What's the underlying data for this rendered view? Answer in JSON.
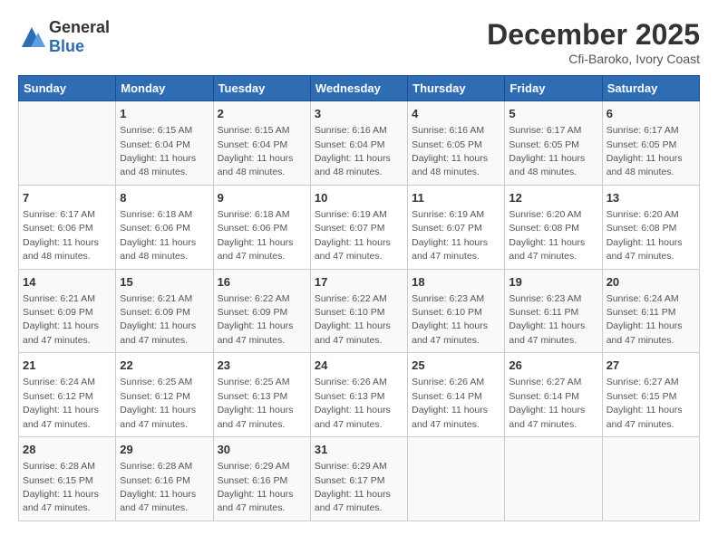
{
  "header": {
    "logo_general": "General",
    "logo_blue": "Blue",
    "month": "December 2025",
    "location": "Cfi-Baroko, Ivory Coast"
  },
  "days_of_week": [
    "Sunday",
    "Monday",
    "Tuesday",
    "Wednesday",
    "Thursday",
    "Friday",
    "Saturday"
  ],
  "weeks": [
    [
      {
        "day": "",
        "info": ""
      },
      {
        "day": "1",
        "info": "Sunrise: 6:15 AM\nSunset: 6:04 PM\nDaylight: 11 hours\nand 48 minutes."
      },
      {
        "day": "2",
        "info": "Sunrise: 6:15 AM\nSunset: 6:04 PM\nDaylight: 11 hours\nand 48 minutes."
      },
      {
        "day": "3",
        "info": "Sunrise: 6:16 AM\nSunset: 6:04 PM\nDaylight: 11 hours\nand 48 minutes."
      },
      {
        "day": "4",
        "info": "Sunrise: 6:16 AM\nSunset: 6:05 PM\nDaylight: 11 hours\nand 48 minutes."
      },
      {
        "day": "5",
        "info": "Sunrise: 6:17 AM\nSunset: 6:05 PM\nDaylight: 11 hours\nand 48 minutes."
      },
      {
        "day": "6",
        "info": "Sunrise: 6:17 AM\nSunset: 6:05 PM\nDaylight: 11 hours\nand 48 minutes."
      }
    ],
    [
      {
        "day": "7",
        "info": "Sunrise: 6:17 AM\nSunset: 6:06 PM\nDaylight: 11 hours\nand 48 minutes."
      },
      {
        "day": "8",
        "info": "Sunrise: 6:18 AM\nSunset: 6:06 PM\nDaylight: 11 hours\nand 48 minutes."
      },
      {
        "day": "9",
        "info": "Sunrise: 6:18 AM\nSunset: 6:06 PM\nDaylight: 11 hours\nand 47 minutes."
      },
      {
        "day": "10",
        "info": "Sunrise: 6:19 AM\nSunset: 6:07 PM\nDaylight: 11 hours\nand 47 minutes."
      },
      {
        "day": "11",
        "info": "Sunrise: 6:19 AM\nSunset: 6:07 PM\nDaylight: 11 hours\nand 47 minutes."
      },
      {
        "day": "12",
        "info": "Sunrise: 6:20 AM\nSunset: 6:08 PM\nDaylight: 11 hours\nand 47 minutes."
      },
      {
        "day": "13",
        "info": "Sunrise: 6:20 AM\nSunset: 6:08 PM\nDaylight: 11 hours\nand 47 minutes."
      }
    ],
    [
      {
        "day": "14",
        "info": "Sunrise: 6:21 AM\nSunset: 6:09 PM\nDaylight: 11 hours\nand 47 minutes."
      },
      {
        "day": "15",
        "info": "Sunrise: 6:21 AM\nSunset: 6:09 PM\nDaylight: 11 hours\nand 47 minutes."
      },
      {
        "day": "16",
        "info": "Sunrise: 6:22 AM\nSunset: 6:09 PM\nDaylight: 11 hours\nand 47 minutes."
      },
      {
        "day": "17",
        "info": "Sunrise: 6:22 AM\nSunset: 6:10 PM\nDaylight: 11 hours\nand 47 minutes."
      },
      {
        "day": "18",
        "info": "Sunrise: 6:23 AM\nSunset: 6:10 PM\nDaylight: 11 hours\nand 47 minutes."
      },
      {
        "day": "19",
        "info": "Sunrise: 6:23 AM\nSunset: 6:11 PM\nDaylight: 11 hours\nand 47 minutes."
      },
      {
        "day": "20",
        "info": "Sunrise: 6:24 AM\nSunset: 6:11 PM\nDaylight: 11 hours\nand 47 minutes."
      }
    ],
    [
      {
        "day": "21",
        "info": "Sunrise: 6:24 AM\nSunset: 6:12 PM\nDaylight: 11 hours\nand 47 minutes."
      },
      {
        "day": "22",
        "info": "Sunrise: 6:25 AM\nSunset: 6:12 PM\nDaylight: 11 hours\nand 47 minutes."
      },
      {
        "day": "23",
        "info": "Sunrise: 6:25 AM\nSunset: 6:13 PM\nDaylight: 11 hours\nand 47 minutes."
      },
      {
        "day": "24",
        "info": "Sunrise: 6:26 AM\nSunset: 6:13 PM\nDaylight: 11 hours\nand 47 minutes."
      },
      {
        "day": "25",
        "info": "Sunrise: 6:26 AM\nSunset: 6:14 PM\nDaylight: 11 hours\nand 47 minutes."
      },
      {
        "day": "26",
        "info": "Sunrise: 6:27 AM\nSunset: 6:14 PM\nDaylight: 11 hours\nand 47 minutes."
      },
      {
        "day": "27",
        "info": "Sunrise: 6:27 AM\nSunset: 6:15 PM\nDaylight: 11 hours\nand 47 minutes."
      }
    ],
    [
      {
        "day": "28",
        "info": "Sunrise: 6:28 AM\nSunset: 6:15 PM\nDaylight: 11 hours\nand 47 minutes."
      },
      {
        "day": "29",
        "info": "Sunrise: 6:28 AM\nSunset: 6:16 PM\nDaylight: 11 hours\nand 47 minutes."
      },
      {
        "day": "30",
        "info": "Sunrise: 6:29 AM\nSunset: 6:16 PM\nDaylight: 11 hours\nand 47 minutes."
      },
      {
        "day": "31",
        "info": "Sunrise: 6:29 AM\nSunset: 6:17 PM\nDaylight: 11 hours\nand 47 minutes."
      },
      {
        "day": "",
        "info": ""
      },
      {
        "day": "",
        "info": ""
      },
      {
        "day": "",
        "info": ""
      }
    ]
  ]
}
